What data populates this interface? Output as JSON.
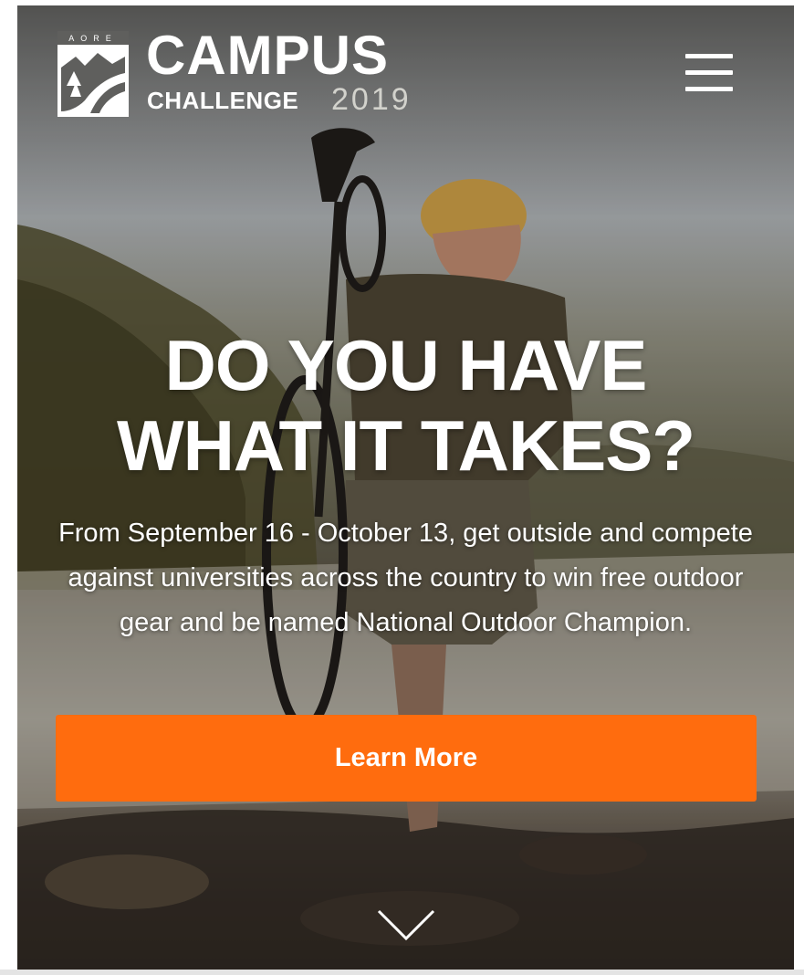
{
  "brand": {
    "emblem_text": "AORE",
    "title": "CAMPUS",
    "subtitle": "CHALLENGE",
    "year": "2019"
  },
  "nav": {
    "menu_icon": "hamburger-menu-icon"
  },
  "hero": {
    "headline_line1": "DO YOU HAVE",
    "headline_line2": "WHAT IT TAKES?",
    "description": "From September 16 - October 13, get outside and compete against universities across the country to win free outdoor gear and be named National Outdoor Champion.",
    "cta_label": "Learn More",
    "scroll_icon": "chevron-down-icon"
  },
  "colors": {
    "accent": "#ff6c0e",
    "text": "#ffffff",
    "year_text": "#d2d2cc"
  }
}
